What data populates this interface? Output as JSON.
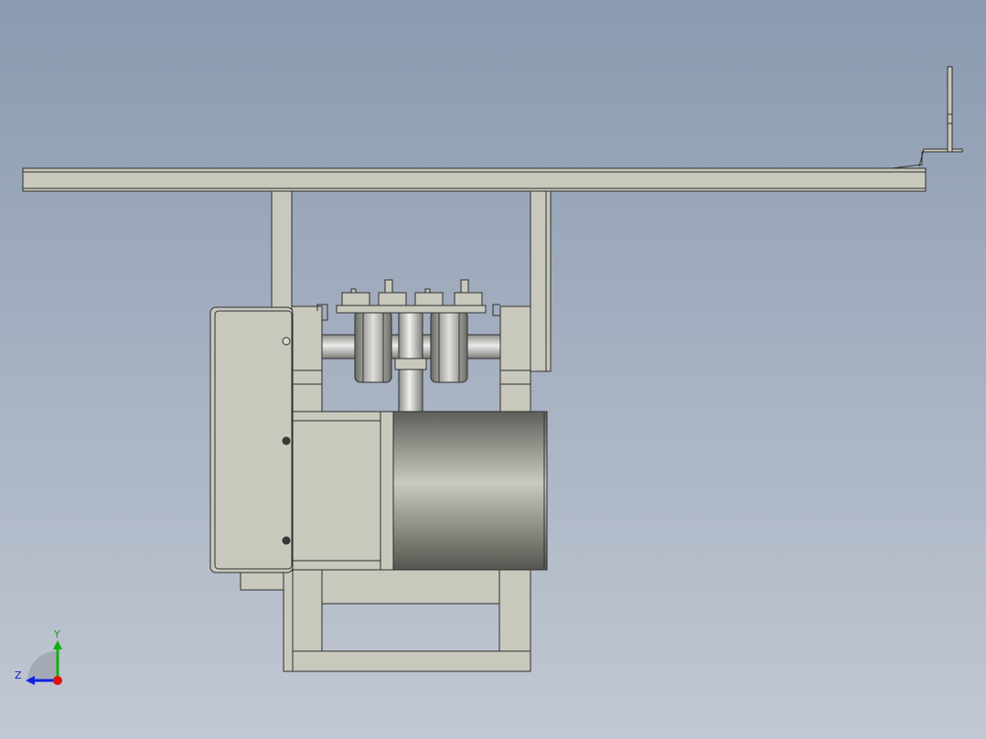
{
  "viewport": {
    "background_top": "#8a9ab0",
    "background_bottom": "#c2c8d3"
  },
  "colors": {
    "part_fill": "#c8c8bc",
    "part_edge": "#2e2e2e",
    "motor_dark": "#6e6e68",
    "motor_light": "#c9c9c0"
  },
  "triad": {
    "y_label": "Y",
    "z_label": "Z",
    "x_axis_color": "#e01010",
    "y_axis_color": "#10b010",
    "z_axis_color": "#1020e0"
  }
}
